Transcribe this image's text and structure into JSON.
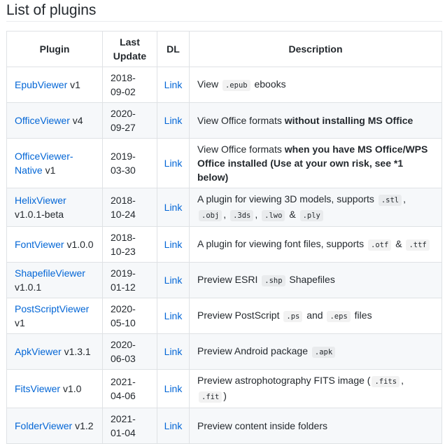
{
  "title": "List of plugins",
  "headers": {
    "plugin": "Plugin",
    "last_update": "Last Update",
    "dl": "DL",
    "description": "Description"
  },
  "colors": {
    "link": "#0366d6",
    "stripe": "#f6f8fa",
    "border": "#dfe2e5"
  },
  "rows": [
    {
      "name": "EpubViewer",
      "version": "v1",
      "date": "2018-09-02",
      "dl": "Link",
      "desc": [
        {
          "t": "text",
          "v": "View "
        },
        {
          "t": "code",
          "v": ".epub"
        },
        {
          "t": "text",
          "v": " ebooks"
        }
      ]
    },
    {
      "name": "OfficeViewer",
      "version": "v4",
      "date": "2020-09-27",
      "dl": "Link",
      "desc": [
        {
          "t": "text",
          "v": "View Office formats "
        },
        {
          "t": "bold",
          "v": "without installing MS Office"
        }
      ]
    },
    {
      "name": "OfficeViewer-Native",
      "version": "v1",
      "date": "2019-03-30",
      "dl": "Link",
      "desc": [
        {
          "t": "text",
          "v": "View Office formats "
        },
        {
          "t": "bold",
          "v": "when you have MS Office/WPS Office installed (Use at your own risk, see *1 below)"
        }
      ]
    },
    {
      "name": "HelixViewer",
      "version": "v1.0.1-beta",
      "date": "2018-10-24",
      "dl": "Link",
      "desc": [
        {
          "t": "text",
          "v": "A plugin for viewing 3D models, supports "
        },
        {
          "t": "code",
          "v": ".stl"
        },
        {
          "t": "text",
          "v": ", "
        },
        {
          "t": "code",
          "v": ".obj"
        },
        {
          "t": "text",
          "v": ", "
        },
        {
          "t": "code",
          "v": ".3ds"
        },
        {
          "t": "text",
          "v": ", "
        },
        {
          "t": "code",
          "v": ".lwo"
        },
        {
          "t": "text",
          "v": " & "
        },
        {
          "t": "code",
          "v": ".ply"
        }
      ]
    },
    {
      "name": "FontViewer",
      "version": "v1.0.0",
      "date": "2018-10-23",
      "dl": "Link",
      "desc": [
        {
          "t": "text",
          "v": "A plugin for viewing font files, supports "
        },
        {
          "t": "code",
          "v": ".otf"
        },
        {
          "t": "text",
          "v": " & "
        },
        {
          "t": "code",
          "v": ".ttf"
        }
      ]
    },
    {
      "name": "ShapefileViewer",
      "version": "v1.0.1",
      "date": "2019-01-12",
      "dl": "Link",
      "desc": [
        {
          "t": "text",
          "v": "Preview ESRI "
        },
        {
          "t": "code",
          "v": ".shp"
        },
        {
          "t": "text",
          "v": " Shapefiles"
        }
      ]
    },
    {
      "name": "PostScriptViewer",
      "version": "v1",
      "date": "2020-05-10",
      "dl": "Link",
      "desc": [
        {
          "t": "text",
          "v": "Preview PostScript "
        },
        {
          "t": "code",
          "v": ".ps"
        },
        {
          "t": "text",
          "v": " and "
        },
        {
          "t": "code",
          "v": ".eps"
        },
        {
          "t": "text",
          "v": " files"
        }
      ]
    },
    {
      "name": "ApkViewer",
      "version": "v1.3.1",
      "date": "2020-06-03",
      "dl": "Link",
      "desc": [
        {
          "t": "text",
          "v": "Preview Android package "
        },
        {
          "t": "code",
          "v": ".apk"
        }
      ]
    },
    {
      "name": "FitsViewer",
      "version": "v1.0",
      "date": "2021-04-06",
      "dl": "Link",
      "desc": [
        {
          "t": "text",
          "v": "Preview astrophotography FITS image ("
        },
        {
          "t": "code",
          "v": ".fits"
        },
        {
          "t": "text",
          "v": ", "
        },
        {
          "t": "code",
          "v": ".fit"
        },
        {
          "t": "text",
          "v": ")"
        }
      ]
    },
    {
      "name": "FolderViewer",
      "version": "v1.2",
      "date": "2021-01-04",
      "dl": "Link",
      "desc": [
        {
          "t": "text",
          "v": "Preview content inside folders"
        }
      ]
    }
  ]
}
